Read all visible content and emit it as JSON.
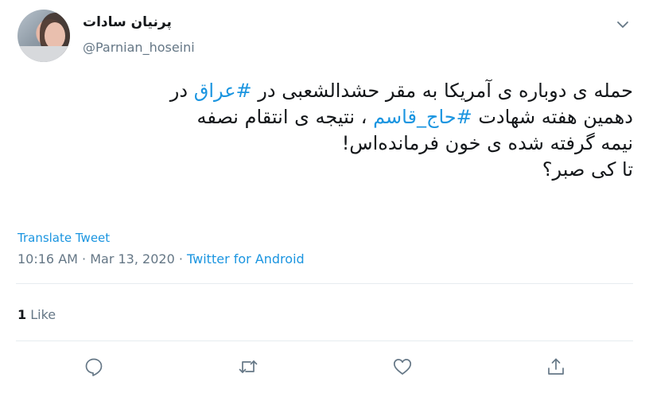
{
  "author": {
    "display_name": "پرنیان سادات",
    "handle": "@Parnian_hoseini"
  },
  "tweet": {
    "line1_pre": "حمله ی دوباره ی آمریکا به مقر حشدالشعبی در ",
    "line1_tag": "#عراق",
    "line1_post": " در",
    "line2_pre": "دهمین هفته شهادت ",
    "line2_tag": "#حاج_قاسم",
    "line2_post": " ، نتیجه ی انتقام نصفه",
    "line3": "نیمه گرفته شده ی خون فرمانده‌اس!",
    "line4": "تا کی صبر؟"
  },
  "translate_label": "Translate Tweet",
  "meta": {
    "time": "10:16 AM",
    "separator1": " · ",
    "date": "Mar 13, 2020",
    "separator2": " · ",
    "source": "Twitter for Android"
  },
  "engagement": {
    "like_count": "1",
    "like_label": "Like"
  },
  "icons": {
    "more": "chevron-down-icon",
    "reply": "reply-icon",
    "retweet": "retweet-icon",
    "like": "heart-icon",
    "share": "share-icon"
  },
  "colors": {
    "link": "#1b95e0",
    "text": "#14171a",
    "muted": "#657786"
  }
}
